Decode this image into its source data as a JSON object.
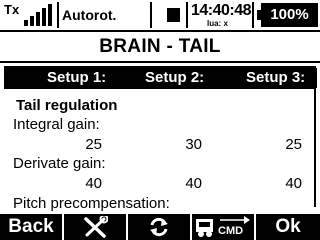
{
  "status": {
    "tx_label": "Tx",
    "mode": "Autorot.",
    "time": "14:40:48",
    "time_sub": "lua: x",
    "battery": "100%"
  },
  "title": "BRAIN - TAIL",
  "columns": [
    "Setup 1:",
    "Setup 2:",
    "Setup 3:"
  ],
  "section": "Tail regulation",
  "rows": [
    {
      "label": "Integral gain:",
      "values": [
        "25",
        "30",
        "25"
      ]
    },
    {
      "label": "Derivate gain:",
      "values": [
        "40",
        "40",
        "40"
      ]
    },
    {
      "label": "Pitch precompensation:",
      "values": []
    }
  ],
  "footer": {
    "back": "Back",
    "wrench_icon": "wrench-screwdriver-icon",
    "swap_icon": "swap-arrows-icon",
    "cmd_label": "CMD",
    "ok": "Ok"
  }
}
